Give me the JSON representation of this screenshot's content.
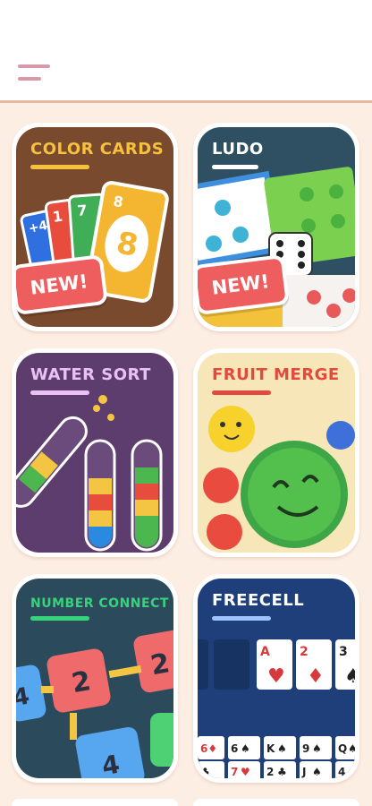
{
  "header": {
    "menu_icon": "hamburger-menu-icon"
  },
  "games": [
    {
      "title": "COLOR CARDS",
      "badge": "NEW!",
      "bg": "#7a4a2e",
      "title_color": "#f6c13d",
      "card_number": "8"
    },
    {
      "title": "LUDO",
      "badge": "NEW!",
      "bg": "#2f5063",
      "title_color": "#ffffff"
    },
    {
      "title": "WATER SORT",
      "bg": "#5d3d6e",
      "title_color": "#e9c2f2"
    },
    {
      "title": "FRUIT MERGE",
      "bg": "#f7e6b7",
      "title_color": "#e34a3f"
    },
    {
      "title": "NUMBER CONNECT",
      "bg": "#2b4b5c",
      "title_color": "#37d37a",
      "tiles": [
        "2",
        "2",
        "4",
        "4"
      ]
    },
    {
      "title": "FREECELL",
      "bg": "#1e3f7a",
      "title_color": "#ffffff",
      "top_cards": [
        "A",
        "2",
        "3"
      ],
      "bottom_row_1": [
        "6",
        "6",
        "K",
        "9",
        "Q"
      ],
      "bottom_row_2": [
        "7",
        "2",
        "J",
        "4"
      ]
    }
  ]
}
